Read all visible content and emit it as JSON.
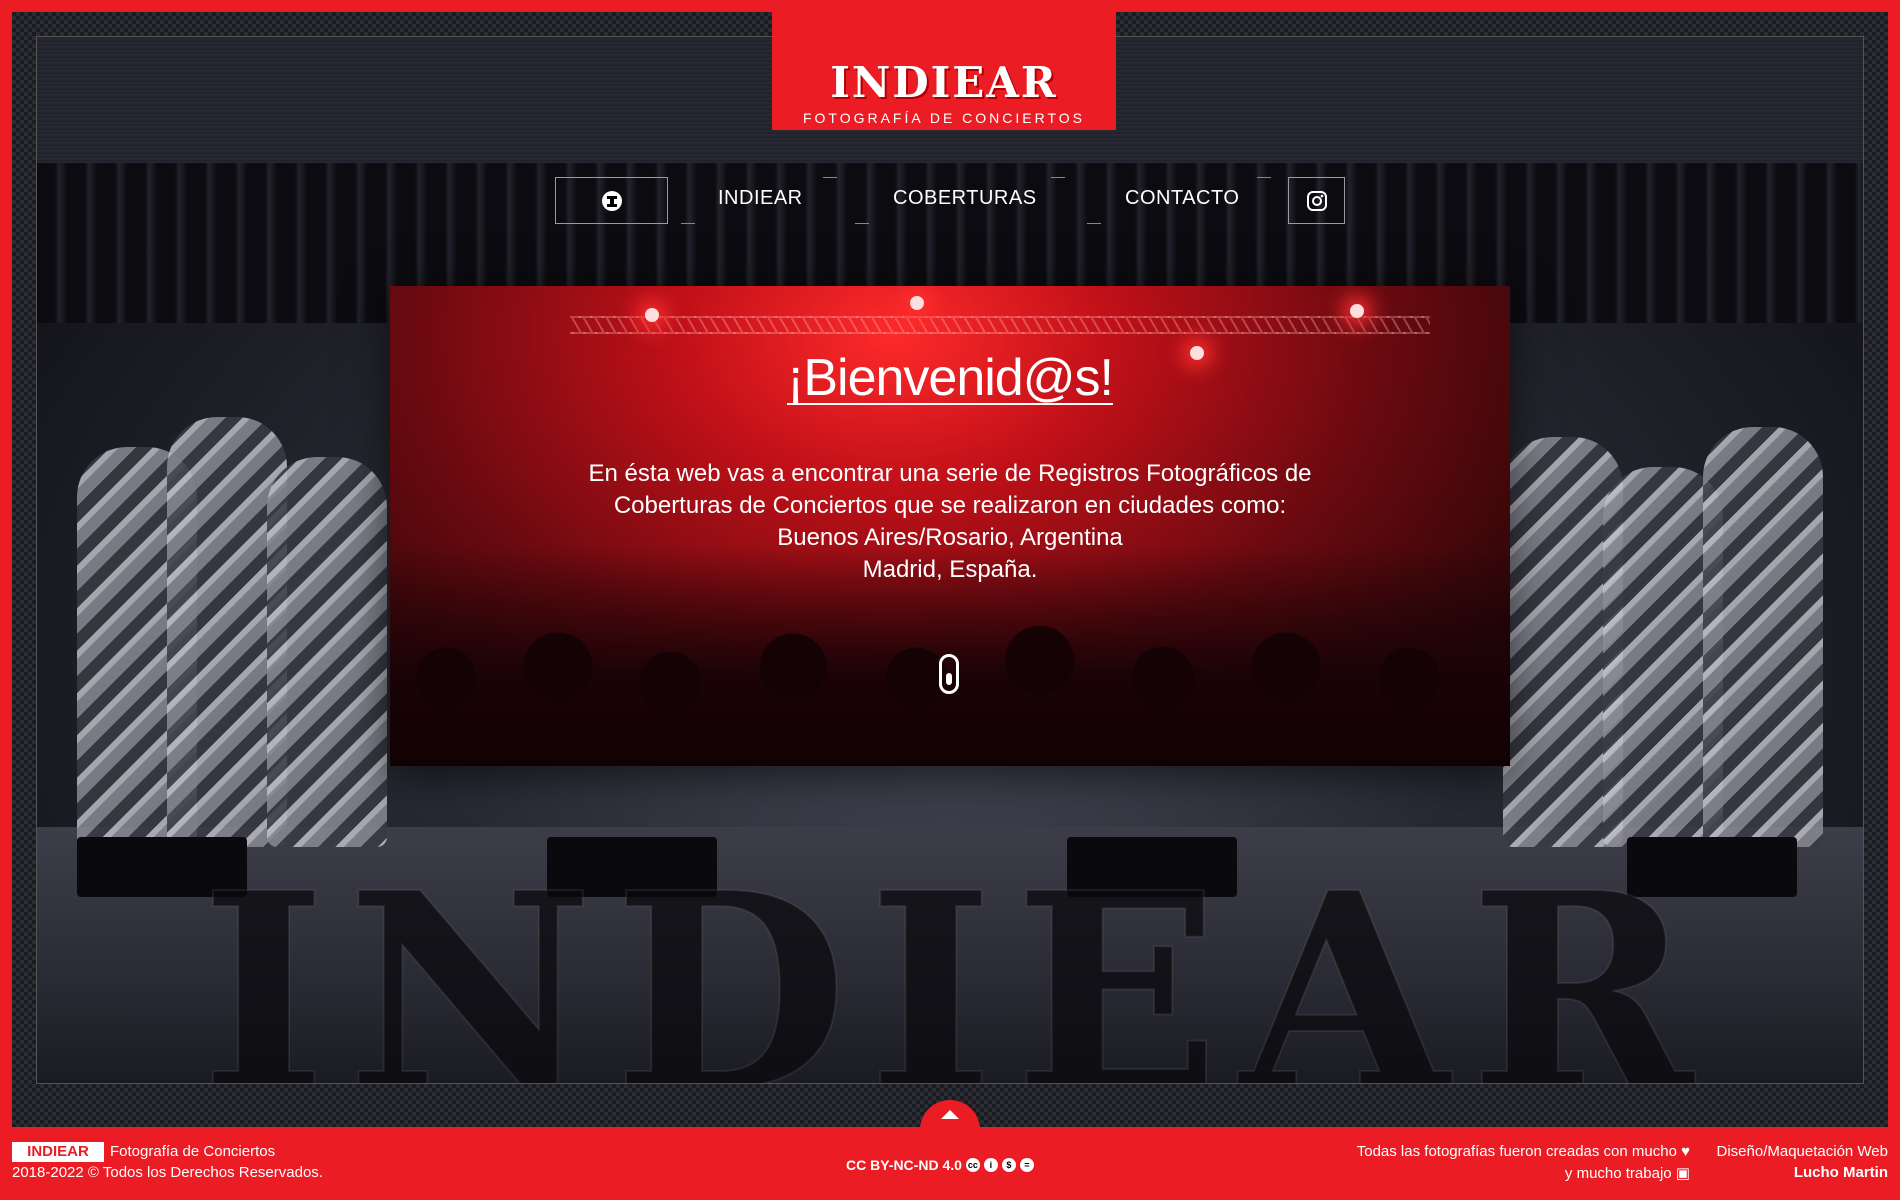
{
  "logo": {
    "title": "INDIEAR",
    "subtitle": "FOTOGRAFÍA DE CONCIERTOS"
  },
  "background_word": "INDIEAR",
  "nav": {
    "items": [
      {
        "label": "INDIEAR"
      },
      {
        "label": "COBERTURAS"
      },
      {
        "label": "CONTACTO"
      }
    ],
    "home_icon": "indiear-logo-icon",
    "instagram_icon": "instagram-icon"
  },
  "welcome": {
    "title": "¡Bienvenid@s!",
    "lines": [
      "En ésta web vas a encontrar una serie de Registros Fotográficos de",
      "Coberturas de Conciertos que se realizaron en ciudades como:",
      "Buenos Aires/Rosario, Argentina",
      "Madrid, España."
    ],
    "scroll_icon": "mouse-scroll-icon"
  },
  "footer": {
    "badge": "INDIEAR",
    "tagline": "Fotografía de Conciertos",
    "copyright": "2018-2022 © Todos los Derechos Reservados.",
    "license": "CC BY-NC-ND 4.0",
    "license_icons": [
      "cc",
      "by",
      "nc",
      "nd"
    ],
    "made_line1": "Todas las fotografías fueron creadas con mucho",
    "made_line2": "y mucho trabajo",
    "design_label": "Diseño/Maquetación Web",
    "author": "Lucho Martin"
  },
  "colors": {
    "brand_red": "#ec1c24",
    "dark": "#15151c"
  }
}
